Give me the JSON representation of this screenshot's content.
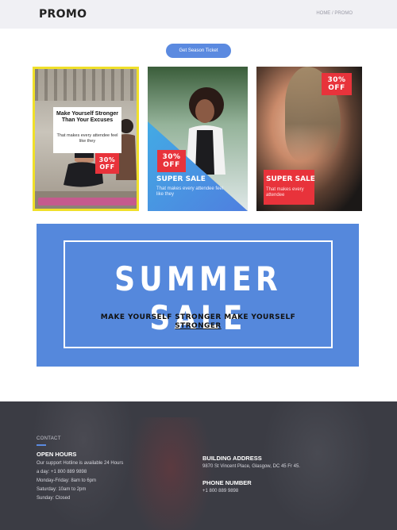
{
  "header": {
    "logo": "PROMO",
    "breadcrumb_home": "HOME",
    "breadcrumb_sep": "/",
    "breadcrumb_current": "PROMO"
  },
  "ticket_button": "Get Season Ticket",
  "cards": [
    {
      "title": "Make Yourself Stronger Than Your Excuses",
      "subtitle": "That makes every attendee feel like they",
      "badge_line1": "30%",
      "badge_line2": "OFF"
    },
    {
      "badge_line1": "30%",
      "badge_line2": "OFF",
      "title": "SUPER SALE",
      "subtitle": "That makes every attendee feel like they"
    },
    {
      "badge_line1": "30%",
      "badge_line2": "OFF",
      "title": "SUPER SALE",
      "subtitle": "That makes every attendee"
    }
  ],
  "banner": {
    "title": "SUMMER SALE",
    "subtitle": "MAKE YOURSELF STRONGER MAKE YOURSELF",
    "subtitle_underlined": "STRONGER"
  },
  "footer": {
    "section_label": "CONTACT",
    "open_hours_heading": "OPEN HOURS",
    "open_hours_lines": [
      "Our support Hotline is available 24 Hours",
      "a day: +1 800 889 9898",
      "Monday-Friday: 8am to 6pm",
      "Saturday: 10am to 2pm",
      "Sunday: Closed"
    ],
    "address_heading": "BUILDING ADDRESS",
    "address": "9870 St Vincent Place, Glasgow, DC 45 Fr 45.",
    "phone_heading": "PHONE NUMBER",
    "phone": "+1 800 889 9898"
  },
  "colors": {
    "accent_blue": "#5588dc",
    "badge_red": "#e8333b",
    "highlight_yellow": "#f0e02a",
    "footer_bg": "#3b3c44"
  }
}
